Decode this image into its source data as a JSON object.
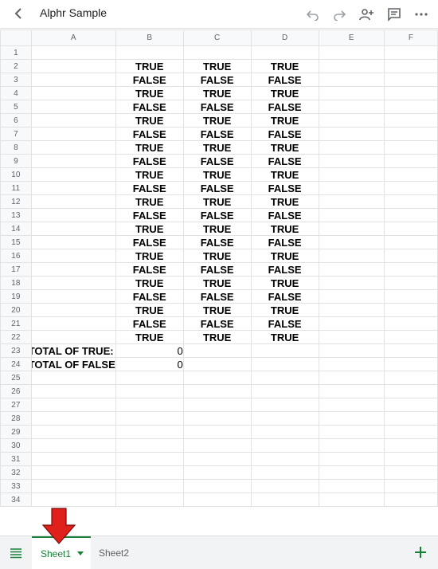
{
  "app": {
    "title": "Alphr Sample"
  },
  "columns": [
    "A",
    "B",
    "C",
    "D",
    "E",
    "F"
  ],
  "rows": [
    {
      "n": "1",
      "a": "",
      "b": "",
      "c": "",
      "d": ""
    },
    {
      "n": "2",
      "a": "",
      "b": "TRUE",
      "c": "TRUE",
      "d": "TRUE"
    },
    {
      "n": "3",
      "a": "",
      "b": "FALSE",
      "c": "FALSE",
      "d": "FALSE"
    },
    {
      "n": "4",
      "a": "",
      "b": "TRUE",
      "c": "TRUE",
      "d": "TRUE"
    },
    {
      "n": "5",
      "a": "",
      "b": "FALSE",
      "c": "FALSE",
      "d": "FALSE"
    },
    {
      "n": "6",
      "a": "",
      "b": "TRUE",
      "c": "TRUE",
      "d": "TRUE"
    },
    {
      "n": "7",
      "a": "",
      "b": "FALSE",
      "c": "FALSE",
      "d": "FALSE"
    },
    {
      "n": "8",
      "a": "",
      "b": "TRUE",
      "c": "TRUE",
      "d": "TRUE"
    },
    {
      "n": "9",
      "a": "",
      "b": "FALSE",
      "c": "FALSE",
      "d": "FALSE"
    },
    {
      "n": "10",
      "a": "",
      "b": "TRUE",
      "c": "TRUE",
      "d": "TRUE"
    },
    {
      "n": "11",
      "a": "",
      "b": "FALSE",
      "c": "FALSE",
      "d": "FALSE"
    },
    {
      "n": "12",
      "a": "",
      "b": "TRUE",
      "c": "TRUE",
      "d": "TRUE"
    },
    {
      "n": "13",
      "a": "",
      "b": "FALSE",
      "c": "FALSE",
      "d": "FALSE"
    },
    {
      "n": "14",
      "a": "",
      "b": "TRUE",
      "c": "TRUE",
      "d": "TRUE"
    },
    {
      "n": "15",
      "a": "",
      "b": "FALSE",
      "c": "FALSE",
      "d": "FALSE"
    },
    {
      "n": "16",
      "a": "",
      "b": "TRUE",
      "c": "TRUE",
      "d": "TRUE"
    },
    {
      "n": "17",
      "a": "",
      "b": "FALSE",
      "c": "FALSE",
      "d": "FALSE"
    },
    {
      "n": "18",
      "a": "",
      "b": "TRUE",
      "c": "TRUE",
      "d": "TRUE"
    },
    {
      "n": "19",
      "a": "",
      "b": "FALSE",
      "c": "FALSE",
      "d": "FALSE"
    },
    {
      "n": "20",
      "a": "",
      "b": "TRUE",
      "c": "TRUE",
      "d": "TRUE"
    },
    {
      "n": "21",
      "a": "",
      "b": "FALSE",
      "c": "FALSE",
      "d": "FALSE"
    },
    {
      "n": "22",
      "a": "",
      "b": "TRUE",
      "c": "TRUE",
      "d": "TRUE"
    },
    {
      "n": "23",
      "a": "TOTAL OF TRUE:",
      "b": "0",
      "c": "",
      "d": ""
    },
    {
      "n": "24",
      "a": "TOTAL OF FALSE",
      "b": "0",
      "c": "",
      "d": ""
    },
    {
      "n": "25",
      "a": "",
      "b": "",
      "c": "",
      "d": ""
    },
    {
      "n": "26",
      "a": "",
      "b": "",
      "c": "",
      "d": ""
    },
    {
      "n": "27",
      "a": "",
      "b": "",
      "c": "",
      "d": ""
    },
    {
      "n": "28",
      "a": "",
      "b": "",
      "c": "",
      "d": ""
    },
    {
      "n": "29",
      "a": "",
      "b": "",
      "c": "",
      "d": ""
    },
    {
      "n": "30",
      "a": "",
      "b": "",
      "c": "",
      "d": ""
    },
    {
      "n": "31",
      "a": "",
      "b": "",
      "c": "",
      "d": ""
    },
    {
      "n": "32",
      "a": "",
      "b": "",
      "c": "",
      "d": ""
    },
    {
      "n": "33",
      "a": "",
      "b": "",
      "c": "",
      "d": ""
    },
    {
      "n": "34",
      "a": "",
      "b": "",
      "c": "",
      "d": ""
    }
  ],
  "sheets": {
    "active": "Sheet1",
    "other": "Sheet2"
  },
  "icons": {
    "back": "back-arrow-icon",
    "undo": "undo-icon",
    "redo": "redo-icon",
    "share": "add-person-icon",
    "comment": "comment-icon",
    "more": "more-icon",
    "menu": "menu-icon",
    "add": "plus-icon",
    "arrow": "red-arrow-down"
  },
  "colors": {
    "accent": "#188038",
    "arrow": "#e0201a",
    "header_bg": "#f8f9fa"
  }
}
